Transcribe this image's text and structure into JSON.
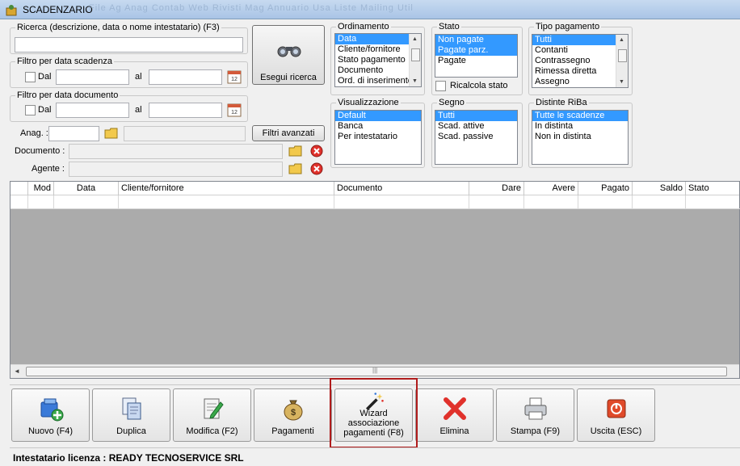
{
  "window": {
    "title": "SCADENZARIO",
    "background_menu_ghost": "File  Ag  Anag  Contab  Web  Rivisti  Mag  Annuario  Usa  Liste  Mailing  Util"
  },
  "search": {
    "label": "Ricerca (descrizione, data o nome intestatario) (F3)",
    "value": "",
    "button_label": "Esegui ricerca"
  },
  "filter_due": {
    "label": "Filtro per data scadenza",
    "from_label": "Dal",
    "to_label": "al",
    "from": "",
    "to": ""
  },
  "filter_doc": {
    "label": "Filtro per data documento",
    "from_label": "Dal",
    "to_label": "al",
    "from": "",
    "to": ""
  },
  "anag": {
    "label": "Anag. :",
    "code": "",
    "name": ""
  },
  "advanced_filters_label": "Filtri avanzati",
  "documento": {
    "label": "Documento :",
    "value": ""
  },
  "agente": {
    "label": "Agente :",
    "value": ""
  },
  "ordinamento": {
    "label": "Ordinamento",
    "items": [
      "Data",
      "Cliente/fornitore",
      "Stato pagamento",
      "Documento",
      "Ord. di inserimento"
    ],
    "selected": 0
  },
  "stato": {
    "label": "Stato",
    "items": [
      "Non pagate",
      "Pagate parz.",
      "Pagate"
    ],
    "selected": [
      0,
      1
    ],
    "recalc_label": "Ricalcola stato"
  },
  "tipo_pagamento": {
    "label": "Tipo pagamento",
    "items": [
      "Tutti",
      "Contanti",
      "Contrassegno",
      "Rimessa diretta",
      "Assegno"
    ],
    "selected": 0
  },
  "visualizzazione": {
    "label": "Visualizzazione",
    "items": [
      "Default",
      "Banca",
      "Per intestatario"
    ],
    "selected": 0
  },
  "segno": {
    "label": "Segno",
    "items": [
      "Tutti",
      "Scad. attive",
      "Scad. passive"
    ],
    "selected": 0
  },
  "distinte": {
    "label": "Distinte RiBa",
    "items": [
      "Tutte le scadenze",
      "In distinta",
      "Non in distinta"
    ],
    "selected": 0
  },
  "grid": {
    "columns": [
      "Mod",
      "Data",
      "Cliente/fornitore",
      "Documento",
      "Dare",
      "Avere",
      "Pagato",
      "Saldo",
      "Stato"
    ],
    "rows": []
  },
  "toolbar": {
    "new": "Nuovo (F4)",
    "duplicate": "Duplica",
    "edit": "Modifica (F2)",
    "payments": "Pagamenti",
    "wizard_line1": "Wizard",
    "wizard_line2": "associazione",
    "wizard_line3": "pagamenti (F8)",
    "delete": "Elimina",
    "print": "Stampa (F9)",
    "exit": "Uscita (ESC)"
  },
  "status": {
    "text": "Intestatario licenza : READY TECNOSERVICE SRL"
  },
  "colors": {
    "selection": "#3399ff",
    "highlight_frame": "#b01c1c",
    "grid_bg": "#ababab"
  }
}
